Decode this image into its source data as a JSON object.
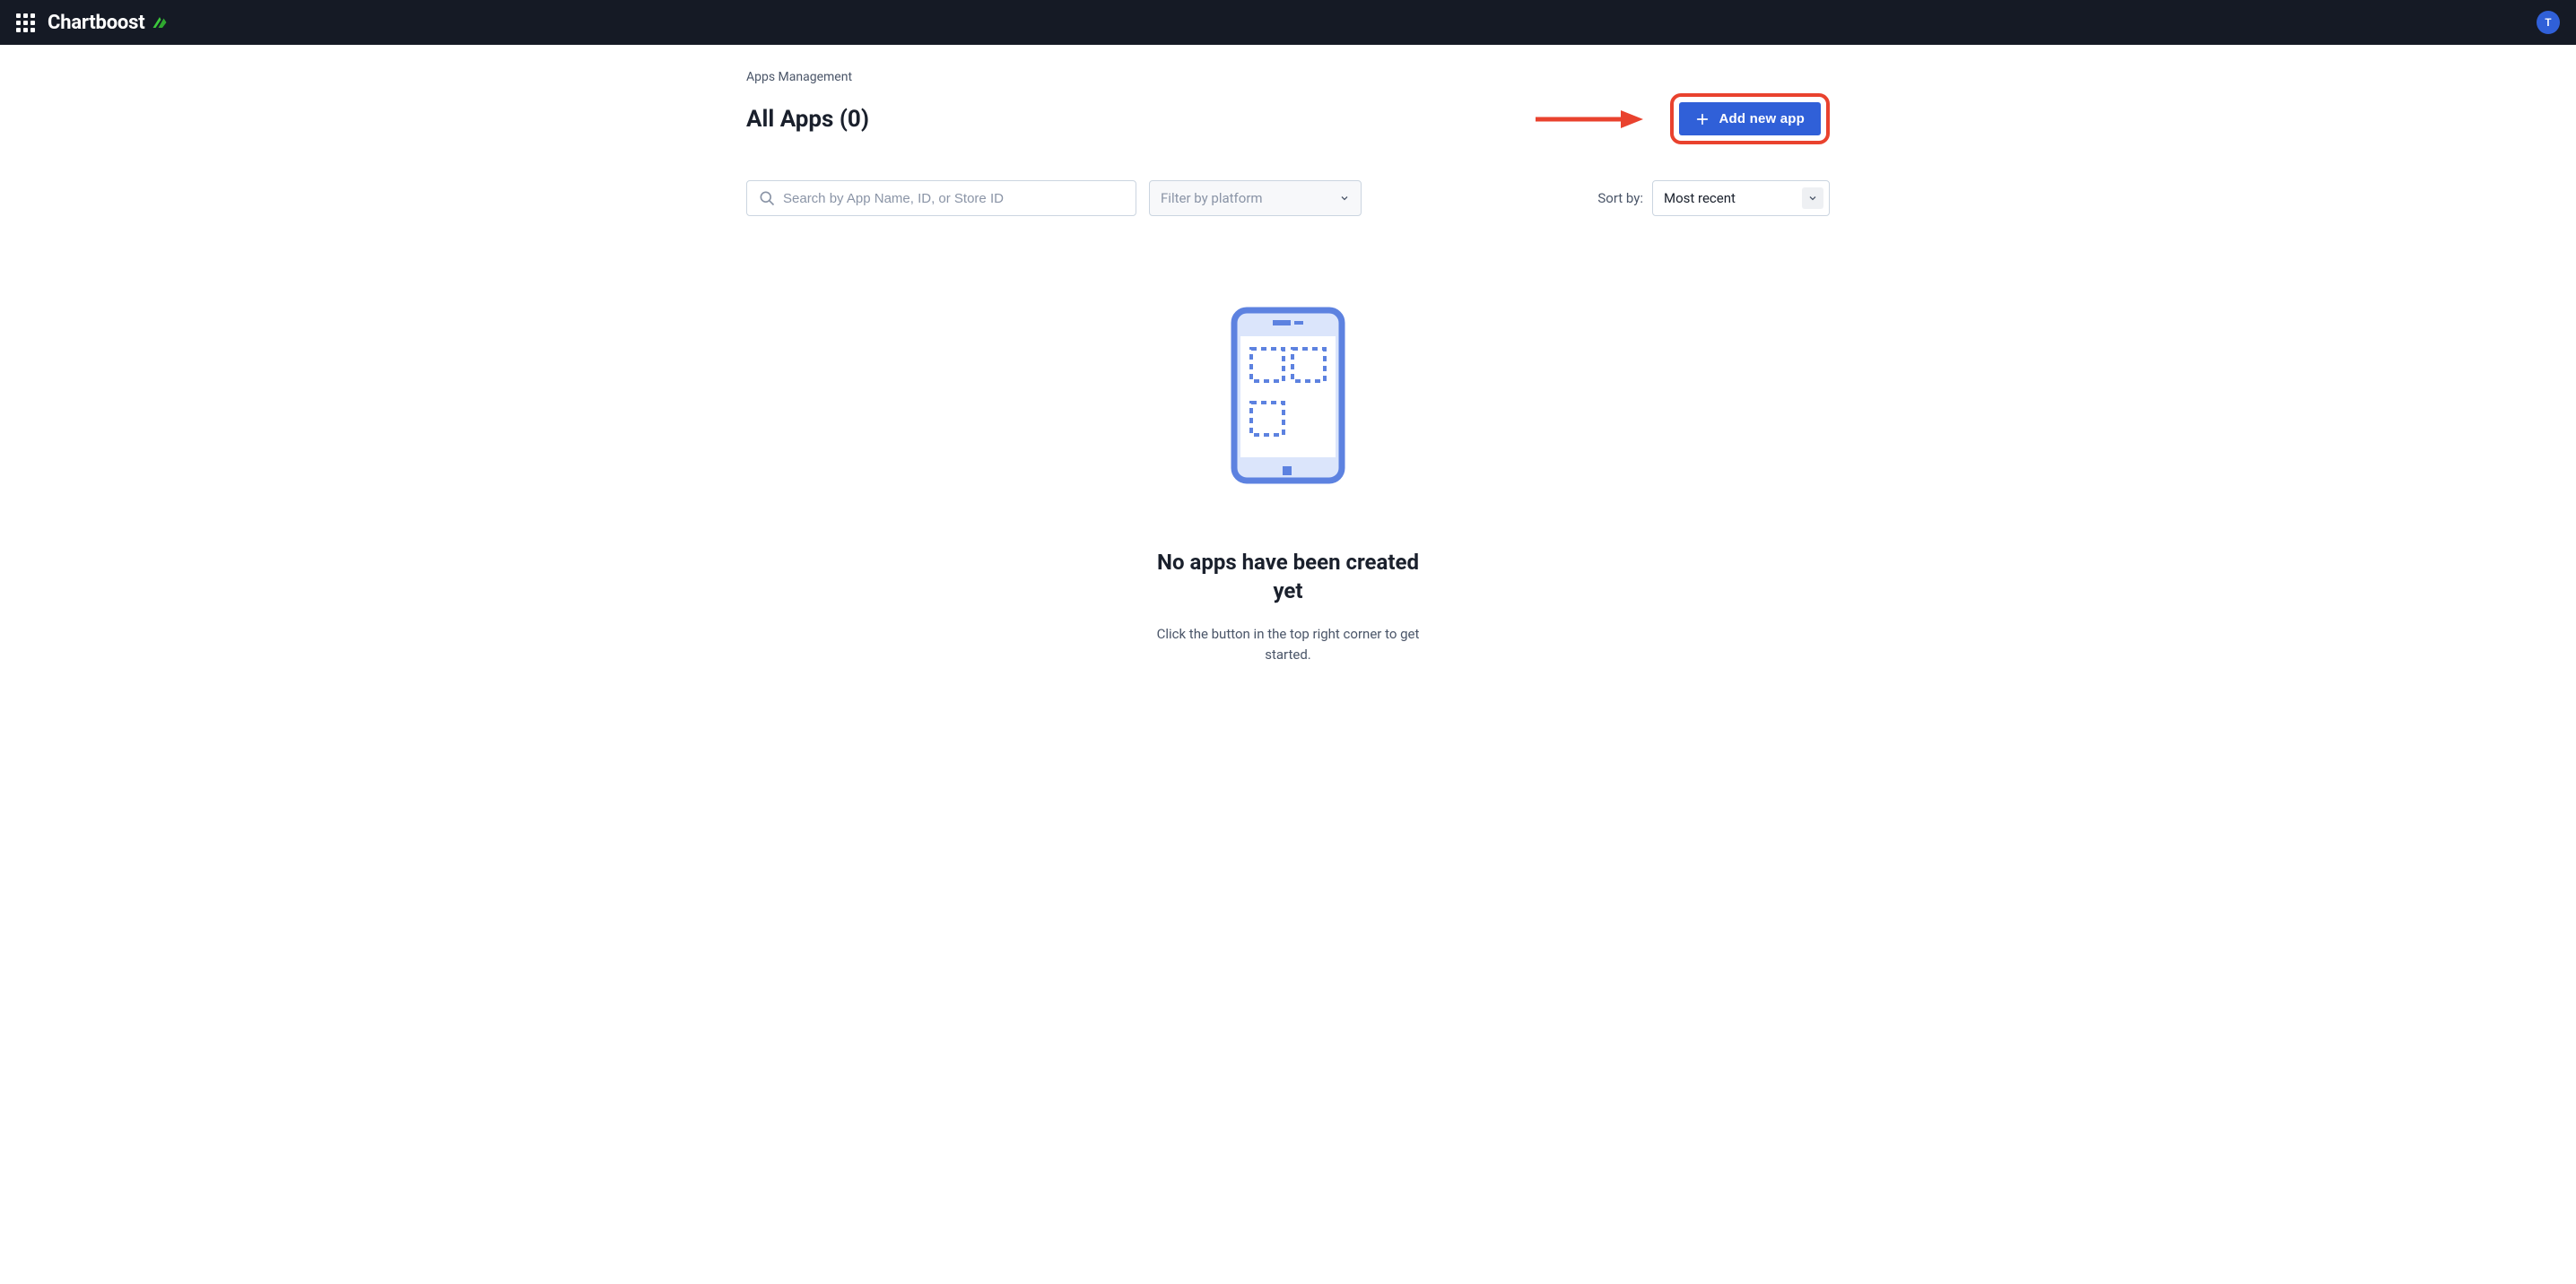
{
  "header": {
    "brand": "Chartboost",
    "avatar_initial": "T"
  },
  "breadcrumb": "Apps Management",
  "page_title": "All Apps (0)",
  "add_button_label": "Add new app",
  "search": {
    "placeholder": "Search by App Name, ID, or Store ID"
  },
  "platform_filter": {
    "placeholder": "Filter by platform"
  },
  "sort": {
    "label": "Sort by:",
    "selected": "Most recent"
  },
  "empty_state": {
    "title": "No apps have been created yet",
    "subtitle": "Click the button in the top right corner to get started."
  }
}
